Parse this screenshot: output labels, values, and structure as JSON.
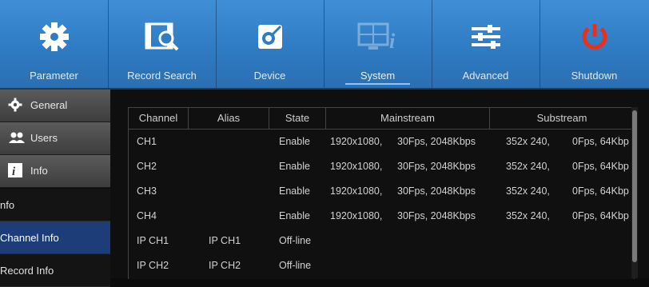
{
  "toolbar": {
    "items": [
      {
        "label": "Parameter",
        "icon": "gear-icon"
      },
      {
        "label": "Record Search",
        "icon": "record-search-icon"
      },
      {
        "label": "Device",
        "icon": "device-icon"
      },
      {
        "label": "System",
        "icon": "system-info-icon",
        "active": true
      },
      {
        "label": "Advanced",
        "icon": "sliders-icon"
      },
      {
        "label": "Shutdown",
        "icon": "power-icon"
      }
    ]
  },
  "sidebar": {
    "items": [
      {
        "label": "General",
        "icon": "gear-icon"
      },
      {
        "label": "Users",
        "icon": "users-icon"
      },
      {
        "label": "Info",
        "icon": "info-icon"
      }
    ],
    "sub_items": [
      {
        "label": "nfo"
      },
      {
        "label": "Channel Info",
        "selected": true
      },
      {
        "label": "Record Info"
      }
    ]
  },
  "table": {
    "columns": [
      "Channel",
      "Alias",
      "State",
      "Mainstream",
      "Substream"
    ],
    "rows": [
      {
        "channel": "CH1",
        "alias": "",
        "state": "Enable",
        "main_res": "1920x1080,",
        "main_rate": "30Fps, 2048Kbps",
        "sub_res": "352x 240,",
        "sub_rate": "0Fps, 64Kbp"
      },
      {
        "channel": "CH2",
        "alias": "",
        "state": "Enable",
        "main_res": "1920x1080,",
        "main_rate": "30Fps, 2048Kbps",
        "sub_res": "352x 240,",
        "sub_rate": "0Fps, 64Kbp"
      },
      {
        "channel": "CH3",
        "alias": "",
        "state": "Enable",
        "main_res": "1920x1080,",
        "main_rate": "30Fps, 2048Kbps",
        "sub_res": "352x 240,",
        "sub_rate": "0Fps, 64Kbp"
      },
      {
        "channel": "CH4",
        "alias": "",
        "state": "Enable",
        "main_res": "1920x1080,",
        "main_rate": "30Fps, 2048Kbps",
        "sub_res": "352x 240,",
        "sub_rate": "0Fps, 64Kbp"
      },
      {
        "channel": "IP CH1",
        "alias": "IP CH1",
        "state": "Off-line",
        "main_res": "",
        "main_rate": "",
        "sub_res": "",
        "sub_rate": ""
      },
      {
        "channel": "IP CH2",
        "alias": "IP CH2",
        "state": "Off-line",
        "main_res": "",
        "main_rate": "",
        "sub_res": "",
        "sub_rate": ""
      }
    ]
  },
  "colors": {
    "toolbar_blue": "#2f7bc4",
    "selected_blue": "#1d3d78",
    "power_red": "#e8301c"
  }
}
